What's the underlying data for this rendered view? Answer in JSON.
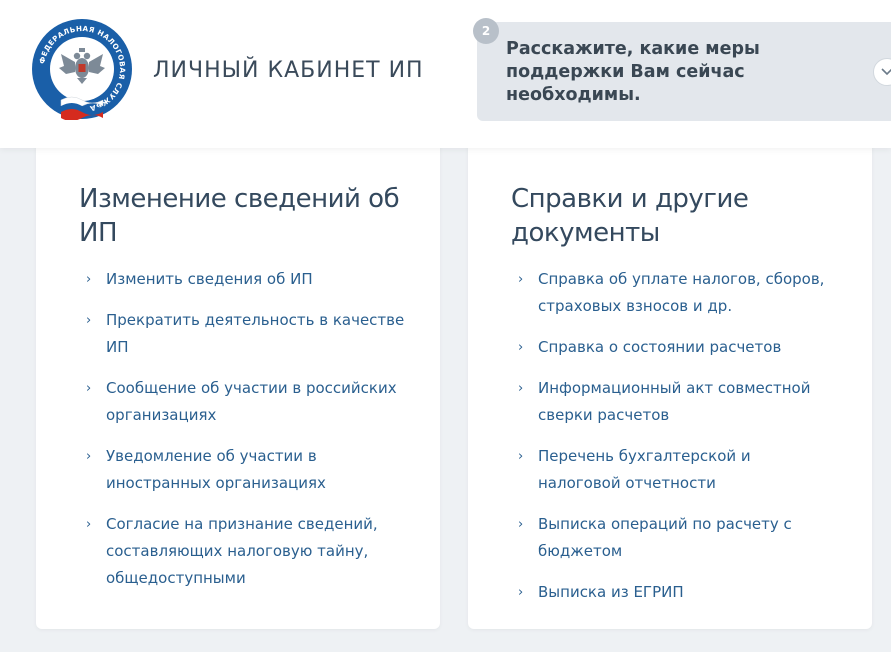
{
  "header": {
    "title": "ЛИЧНЫЙ КАБИНЕТ ИП",
    "logo_ring_text": "ФЕДЕРАЛЬНАЯ НАЛОГОВАЯ СЛУЖБА"
  },
  "survey": {
    "step": "2",
    "question": "Расскажите, какие меры поддержки Вам сейчас необходимы."
  },
  "colors": {
    "link": "#2a5f8f",
    "logo_blue": "#1a5fa8",
    "page_bg": "#eef1f4"
  },
  "cards": [
    {
      "title": "Изменение сведений об ИП",
      "items": [
        "Изменить сведения об ИП",
        "Прекратить деятельность в качестве ИП",
        "Сообщение об участии в российских организациях",
        "Уведомление об участии в иностранных организациях",
        "Согласие на признание сведений, составляющих налоговую тайну, общедоступными"
      ]
    },
    {
      "title": "Справки и другие документы",
      "items": [
        "Справка об уплате налогов, сборов, страховых взносов и др.",
        "Справка о состоянии расчетов",
        "Информационный акт совместной сверки расчетов",
        "Перечень бухгалтерской и налоговой отчетности",
        "Выписка операций по расчету с бюджетом",
        "Выписка из ЕГРИП"
      ]
    }
  ],
  "icons": {
    "list_item": "chevron-right-icon",
    "survey_toggle": "chevron-down-icon"
  }
}
